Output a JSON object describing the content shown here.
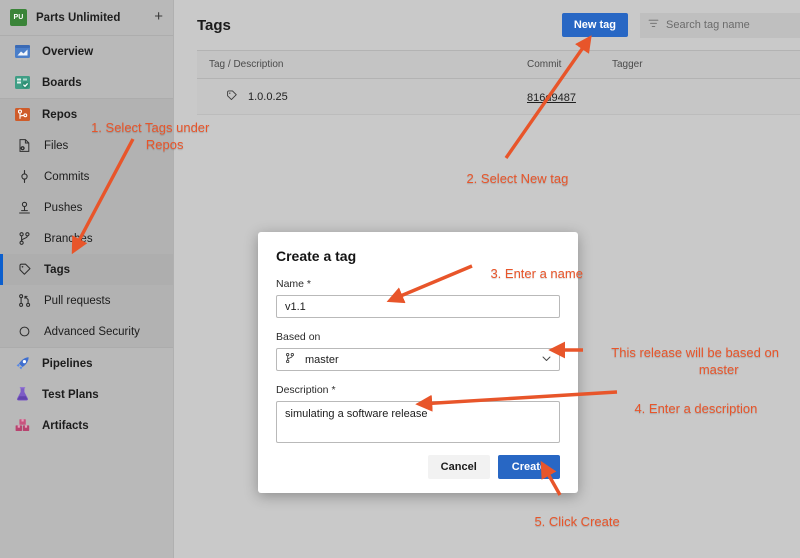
{
  "sidebar": {
    "project": {
      "logo_text": "PU",
      "name": "Parts Unlimited",
      "add_label": "+"
    },
    "items": [
      {
        "label": "Overview",
        "icon": "overview-icon"
      },
      {
        "label": "Boards",
        "icon": "boards-icon"
      },
      {
        "label": "Repos",
        "icon": "repos-icon"
      },
      {
        "label": "Files",
        "icon": "files-icon"
      },
      {
        "label": "Commits",
        "icon": "commits-icon"
      },
      {
        "label": "Pushes",
        "icon": "pushes-icon"
      },
      {
        "label": "Branches",
        "icon": "branches-icon"
      },
      {
        "label": "Tags",
        "icon": "tags-icon"
      },
      {
        "label": "Pull requests",
        "icon": "pull-requests-icon"
      },
      {
        "label": "Advanced Security",
        "icon": "advanced-security-icon"
      },
      {
        "label": "Pipelines",
        "icon": "pipelines-icon"
      },
      {
        "label": "Test Plans",
        "icon": "test-plans-icon"
      },
      {
        "label": "Artifacts",
        "icon": "artifacts-icon"
      }
    ]
  },
  "main": {
    "title": "Tags",
    "new_tag_button": "New tag",
    "search": {
      "placeholder": "Search tag name",
      "icon": "filter-icon"
    },
    "table": {
      "columns": [
        "Tag / Description",
        "Commit",
        "Tagger"
      ],
      "rows": [
        {
          "tag": "1.0.0.25",
          "commit": "816d9487",
          "tagger": ""
        }
      ]
    }
  },
  "modal": {
    "title": "Create a tag",
    "name": {
      "label": "Name *",
      "value": "v1.1"
    },
    "based_on": {
      "label": "Based on",
      "value": "master",
      "icon": "branch-icon"
    },
    "description": {
      "label": "Description *",
      "value": "simulating a software release"
    },
    "cancel_button": "Cancel",
    "create_button": "Create"
  },
  "annotations": {
    "accent_color": "#e8552a",
    "steps": [
      {
        "id": "step-1",
        "text": "1. Select Tags under\n            Repos"
      },
      {
        "id": "step-2",
        "text": "2. Select New tag"
      },
      {
        "id": "step-3",
        "text": "3. Enter a name"
      },
      {
        "id": "step-4",
        "text": "This release will be based on\n                 master"
      },
      {
        "id": "step-5",
        "text": "4. Enter a description"
      },
      {
        "id": "step-6",
        "text": "5. Click Create"
      }
    ]
  },
  "colors": {
    "accent_blue": "#2867c4",
    "annotation_orange": "#e8552a",
    "sidebar_bg": "#b9b9b9",
    "main_bg": "#c9c9c9"
  }
}
